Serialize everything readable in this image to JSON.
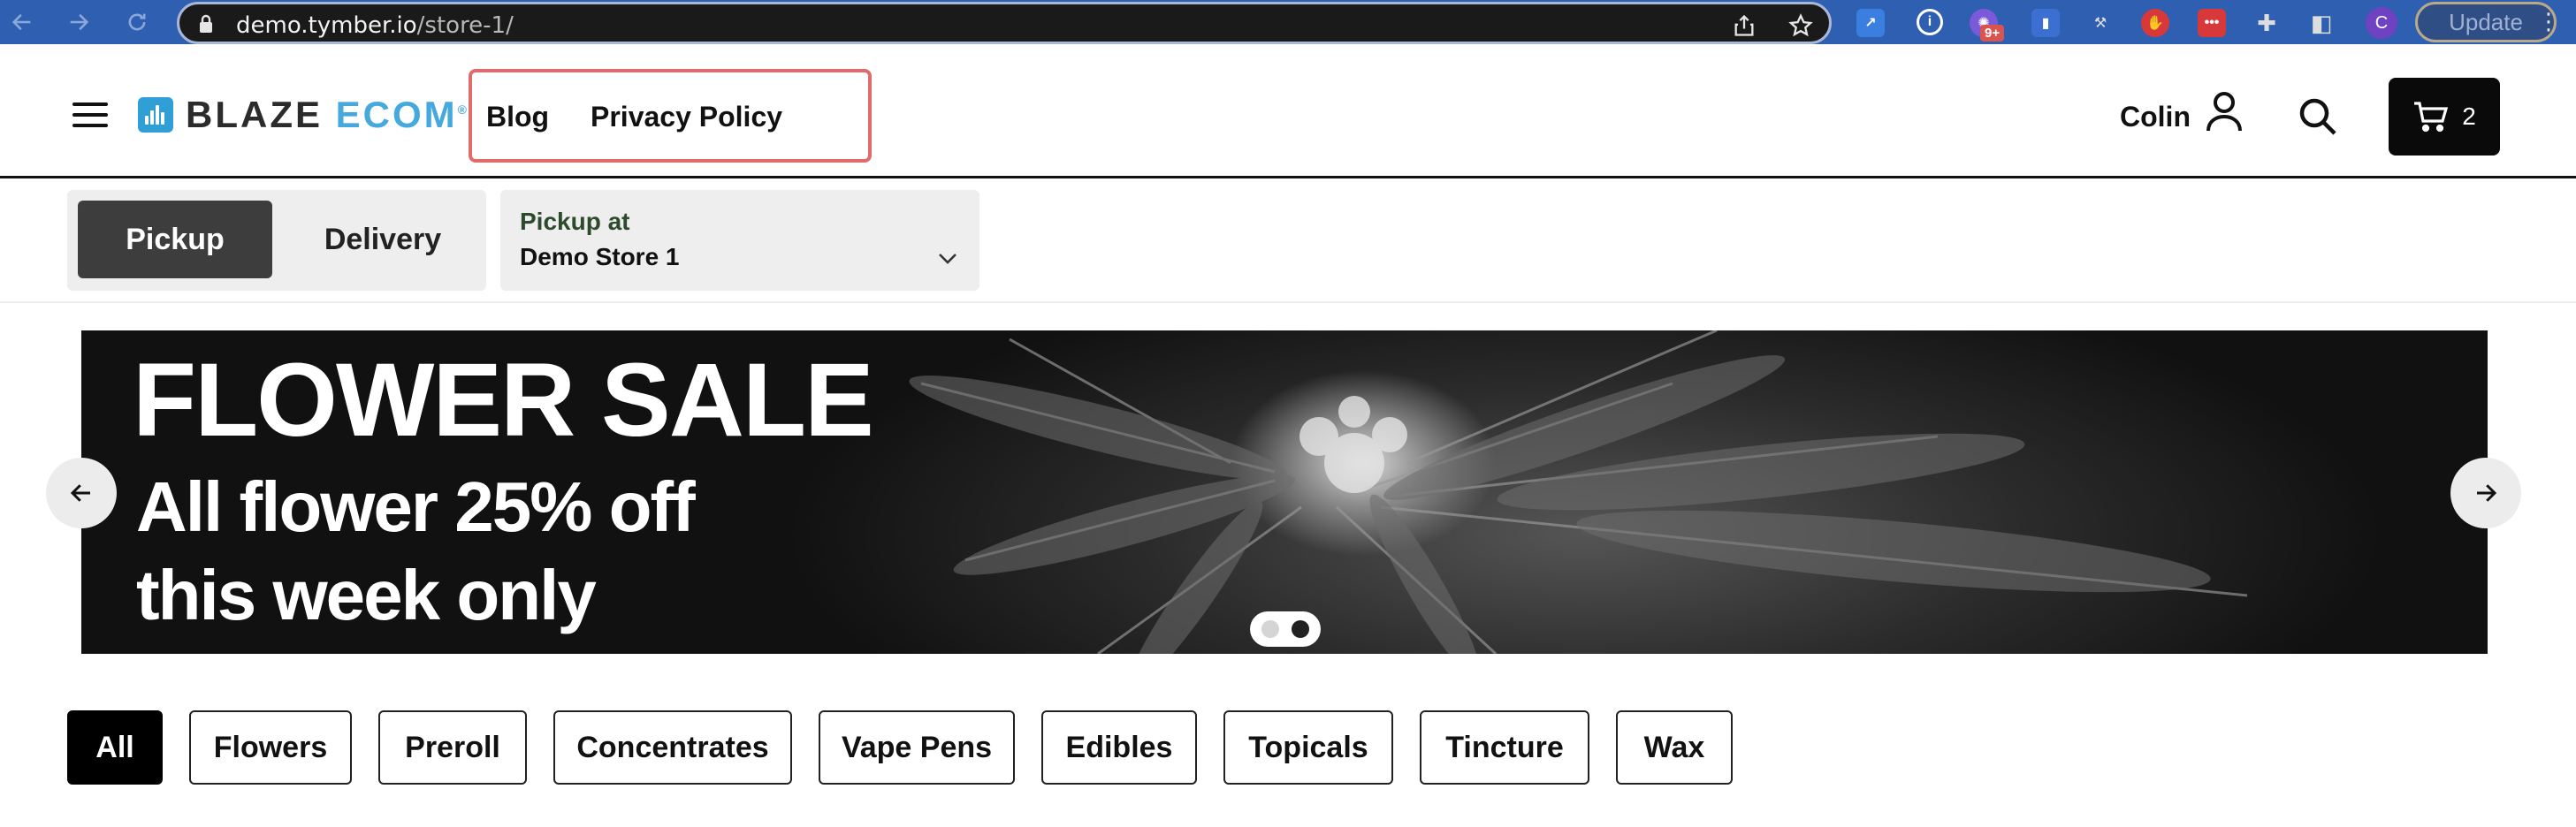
{
  "browser": {
    "url_host": "demo.tymber.io",
    "url_path": "/store-1/",
    "extension_badge": "9+",
    "profile_initial": "C",
    "update_label": "Update"
  },
  "header": {
    "logo_word1": "BLAZE",
    "logo_word2": "ECOM",
    "logo_mark": "®",
    "nav": {
      "blog": "Blog",
      "privacy": "Privacy Policy"
    },
    "user_name": "Colin",
    "cart_count": "2"
  },
  "order_type": {
    "pickup": "Pickup",
    "delivery": "Delivery",
    "selected": "Pickup"
  },
  "store": {
    "label": "Pickup at",
    "value": "Demo Store 1"
  },
  "banner": {
    "title": "FLOWER SALE",
    "line1": "All flower 25% off",
    "line2": "this week only",
    "slide_count": 2,
    "active_slide": 2
  },
  "categories": {
    "all": "All",
    "flowers": "Flowers",
    "preroll": "Preroll",
    "concentrates": "Concentrates",
    "vape_pens": "Vape Pens",
    "edibles": "Edibles",
    "topicals": "Topicals",
    "tincture": "Tincture",
    "wax": "Wax",
    "active": "All"
  },
  "colors": {
    "chrome_bg": "#2f5fb0",
    "logo_blue": "#46a9dd",
    "highlight": "#e06b6b",
    "active_pill": "#000000",
    "active_toggle": "#3d3d3d"
  },
  "icons": {
    "menu": "hamburger-icon",
    "user": "user-icon",
    "search": "search-icon",
    "cart": "cart-icon",
    "prev": "arrow-left-icon",
    "next": "arrow-right-icon",
    "dropdown": "chevron-down-icon"
  }
}
